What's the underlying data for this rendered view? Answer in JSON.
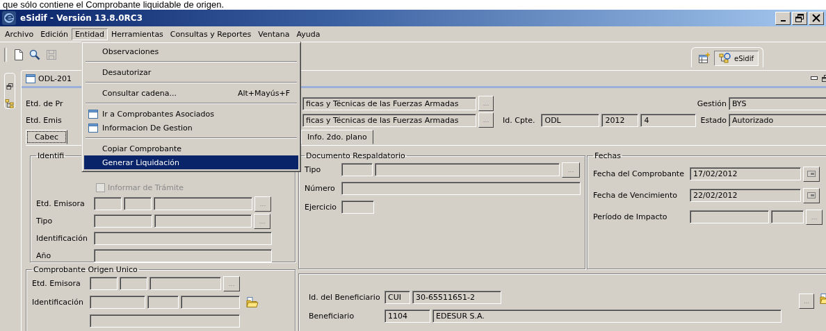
{
  "caption": "que sólo contiene el Comprobante liquidable de origen.",
  "window": {
    "title": "eSidif - Versión 13.8.0RC3"
  },
  "menu_bar": [
    {
      "label": "Archivo",
      "selected": false
    },
    {
      "label": "Edición",
      "selected": false
    },
    {
      "label": "Entidad",
      "selected": true
    },
    {
      "label": "Herramientas",
      "selected": false
    },
    {
      "label": "Consultas y Reportes",
      "selected": false
    },
    {
      "label": "Ventana",
      "selected": false
    },
    {
      "label": "Ayuda",
      "selected": false
    }
  ],
  "open_menu": [
    {
      "kind": "item",
      "label": "Observaciones",
      "selected": false
    },
    {
      "kind": "separator"
    },
    {
      "kind": "item",
      "label": "Desautorizar",
      "selected": false
    },
    {
      "kind": "separator"
    },
    {
      "kind": "item",
      "label": "Consultar cadena...",
      "shortcut": "Alt+Mayús+F",
      "selected": false
    },
    {
      "kind": "separator"
    },
    {
      "kind": "icon_item",
      "label": "Ir a Comprobantes Asociados",
      "selected": false
    },
    {
      "kind": "icon_item",
      "label": "Informacion De Gestion",
      "selected": false
    },
    {
      "kind": "separator"
    },
    {
      "kind": "item",
      "label": "Copiar Comprobante",
      "selected": false
    },
    {
      "kind": "item",
      "label": "Generar Liquidación",
      "selected": true
    }
  ],
  "perspective": {
    "label": "eSidif"
  },
  "editor_tab": {
    "label": "ODL-201"
  },
  "header": {
    "etd_de_pr": {
      "label": "Etd. de Pr",
      "value": "ficas y Técnicas de las Fuerzas Armadas",
      "button": "..."
    },
    "etd_emisora": {
      "label": "Etd. Emis",
      "value": "ficas y Técnicas de las Fuerzas Armadas",
      "button": "..."
    },
    "gestion": {
      "label": "Gestión",
      "value": "BYS"
    },
    "id_cpte": {
      "label": "Id. Cpte.",
      "values": [
        "ODL",
        "2012",
        "4"
      ]
    },
    "estado": {
      "label": "Estado",
      "value": "Autorizado"
    }
  },
  "tabs": [
    {
      "label": "Cabec",
      "selected": true
    },
    {
      "label": "Info. 2do. plano",
      "selected": false
    }
  ],
  "identificacion": {
    "legend": "Identifi",
    "checkbox": {
      "label": "Informar de Trámite",
      "checked": false,
      "disabled": true
    },
    "rows": [
      {
        "label": "Etd. Emisora",
        "fields": [
          {
            "kind": "text"
          },
          {
            "kind": "text"
          },
          {
            "kind": "text"
          },
          {
            "kind": "browse",
            "label": "..."
          }
        ]
      },
      {
        "label": "Tipo",
        "fields": [
          {
            "kind": "text"
          },
          {
            "kind": "text"
          },
          {
            "kind": "browse",
            "label": "..."
          }
        ]
      },
      {
        "label": "Identificación",
        "fields": [
          {
            "kind": "text"
          }
        ]
      },
      {
        "label": "Año",
        "fields": [
          {
            "kind": "text"
          }
        ]
      }
    ]
  },
  "origen": {
    "legend": "Comprobante Origen Unico",
    "rows": [
      {
        "label": "Etd. Emisora",
        "fields": [
          {
            "kind": "text"
          },
          {
            "kind": "text"
          },
          {
            "kind": "text"
          },
          {
            "kind": "browse",
            "label": "..."
          }
        ]
      },
      {
        "label": "Identificación",
        "fields": [
          {
            "kind": "text"
          },
          {
            "kind": "text"
          },
          {
            "kind": "text"
          },
          {
            "kind": "folder"
          }
        ]
      },
      {
        "fields": [
          {
            "kind": "text"
          }
        ]
      }
    ]
  },
  "documento": {
    "legend": "Documento Respaldatorio",
    "rows": [
      {
        "label": "Tipo",
        "fields": [
          {
            "kind": "text"
          },
          {
            "kind": "text"
          },
          {
            "kind": "browse",
            "label": "..."
          }
        ]
      },
      {
        "label": "Número",
        "fields": [
          {
            "kind": "text"
          }
        ]
      },
      {
        "label": "Ejercicio",
        "fields": [
          {
            "kind": "text"
          }
        ]
      }
    ]
  },
  "fechas": {
    "legend": "Fechas",
    "rows": [
      {
        "label": "Fecha del Comprobante",
        "fields": [
          {
            "kind": "text",
            "value": "17/02/2012"
          },
          {
            "kind": "calendar"
          }
        ]
      },
      {
        "label": "Fecha de Vencimiento",
        "fields": [
          {
            "kind": "text",
            "value": "22/02/2012"
          },
          {
            "kind": "calendar"
          }
        ]
      },
      {
        "label": "Período de Impacto",
        "fields": [
          {
            "kind": "text"
          },
          {
            "kind": "text"
          },
          {
            "kind": "browse",
            "label": "..."
          }
        ]
      }
    ]
  },
  "beneficiario": {
    "rows": [
      {
        "label": "Id. del Beneficiario",
        "fields": [
          {
            "kind": "text",
            "value": "CUI"
          },
          {
            "kind": "text",
            "value": "30-65511651-2"
          }
        ]
      },
      {
        "label": "Beneficiario",
        "fields": [
          {
            "kind": "text",
            "value": "1104"
          },
          {
            "kind": "text",
            "value": "EDESUR S.A."
          }
        ]
      }
    ],
    "buttons": [
      {
        "kind": "browse",
        "label": "..."
      },
      {
        "kind": "folder"
      }
    ]
  }
}
